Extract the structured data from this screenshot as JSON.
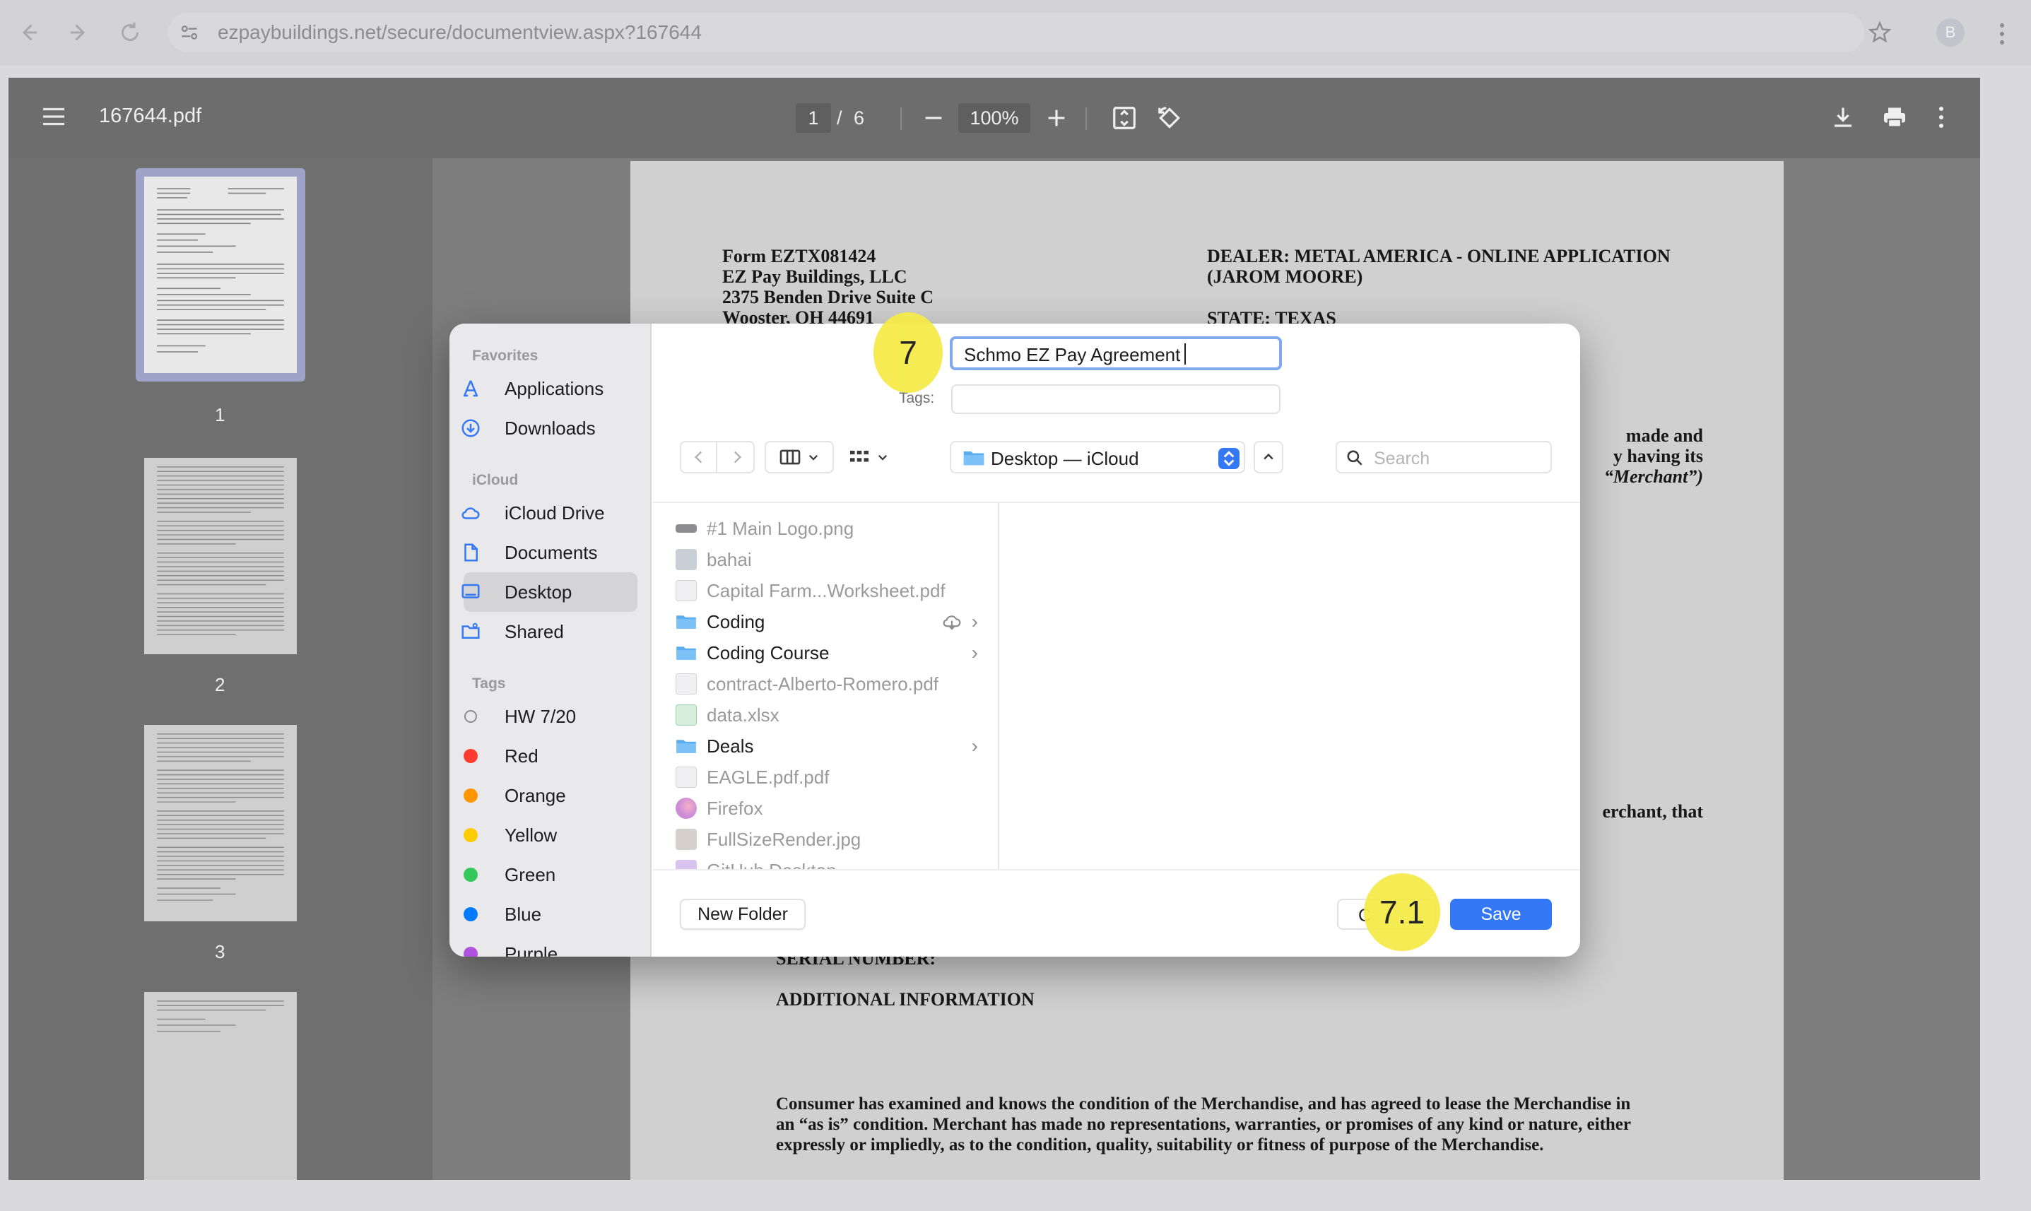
{
  "browser": {
    "url": "ezpaybuildings.net/secure/documentview.aspx?167644",
    "profile_initial": "B"
  },
  "pdf_viewer": {
    "filename": "167644.pdf",
    "page_current": "1",
    "page_separator": "/",
    "page_total": "6",
    "zoom": "100%",
    "thumbnails": [
      {
        "label": "1"
      },
      {
        "label": "2"
      },
      {
        "label": "3"
      }
    ]
  },
  "document": {
    "left_header": [
      "Form EZTX081424",
      "EZ Pay Buildings, LLC",
      "2375 Benden Drive Suite C",
      "Wooster, OH 44691"
    ],
    "right_header": [
      "DEALER: METAL AMERICA - ONLINE APPLICATION",
      "(JAROM MOORE)"
    ],
    "state_line": "STATE: TEXAS",
    "partial_right": [
      "made and",
      "y having its",
      "“Merchant”)"
    ],
    "partial_merchant": "erchant, that",
    "serial_number": "SERIAL NUMBER:",
    "additional_info": "ADDITIONAL INFORMATION",
    "paragraph": [
      "Consumer has examined and knows the condition of the Merchandise, and has agreed to lease the Merchandise in",
      "an “as is” condition.  Merchant has made no representations, warranties, or promises of any kind or nature, either",
      "expressly or impliedly, as to the condition, quality, suitability or fitness of purpose of the Merchandise."
    ]
  },
  "save_dialog": {
    "filename_value": "Schmo EZ Pay Agreement",
    "tags_label": "Tags:",
    "location": "Desktop — iCloud",
    "search_placeholder": "Search",
    "sidebar": {
      "favorites_header": "Favorites",
      "favorites": [
        {
          "label": "Applications",
          "icon": "applications-icon"
        },
        {
          "label": "Downloads",
          "icon": "downloads-icon"
        }
      ],
      "icloud_header": "iCloud",
      "icloud": [
        {
          "label": "iCloud Drive",
          "icon": "cloud-icon"
        },
        {
          "label": "Documents",
          "icon": "document-icon"
        },
        {
          "label": "Desktop",
          "icon": "desktop-icon",
          "selected": true
        },
        {
          "label": "Shared",
          "icon": "shared-folder-icon"
        }
      ],
      "tags_header": "Tags",
      "tags": [
        {
          "label": "HW 7/20",
          "color": ""
        },
        {
          "label": "Red",
          "color": "#ff3b30"
        },
        {
          "label": "Orange",
          "color": "#ff9500"
        },
        {
          "label": "Yellow",
          "color": "#ffcc00"
        },
        {
          "label": "Green",
          "color": "#34c759"
        },
        {
          "label": "Blue",
          "color": "#007aff"
        },
        {
          "label": "Purple",
          "color": "#af52de"
        }
      ]
    },
    "files": [
      {
        "name": "#1 Main Logo.png",
        "type": "image",
        "enabled": false
      },
      {
        "name": "bahai",
        "type": "image",
        "enabled": false
      },
      {
        "name": "Capital Farm...Worksheet.pdf",
        "type": "pdf",
        "enabled": false
      },
      {
        "name": "Coding",
        "type": "folder",
        "enabled": true,
        "cloud": true
      },
      {
        "name": "Coding Course",
        "type": "folder",
        "enabled": true
      },
      {
        "name": "contract-Alberto-Romero.pdf",
        "type": "pdf",
        "enabled": false
      },
      {
        "name": "data.xlsx",
        "type": "xlsx",
        "enabled": false
      },
      {
        "name": "Deals",
        "type": "folder",
        "enabled": true
      },
      {
        "name": "EAGLE.pdf.pdf",
        "type": "pdf",
        "enabled": false
      },
      {
        "name": "Firefox",
        "type": "app",
        "enabled": false
      },
      {
        "name": "FullSizeRender.jpg",
        "type": "image",
        "enabled": false
      },
      {
        "name": "GitHub Desktop",
        "type": "app",
        "enabled": false
      }
    ],
    "new_folder_label": "New Folder",
    "cancel_label": "Cancel",
    "cancel_visible": "C",
    "save_label": "Save"
  },
  "annotations": [
    {
      "label": "7"
    },
    {
      "label": "7.1"
    }
  ],
  "colors": {
    "accent": "#3478f6",
    "highlight_marker": "#f5ea4a",
    "folder_blue": "#5aaef0"
  }
}
